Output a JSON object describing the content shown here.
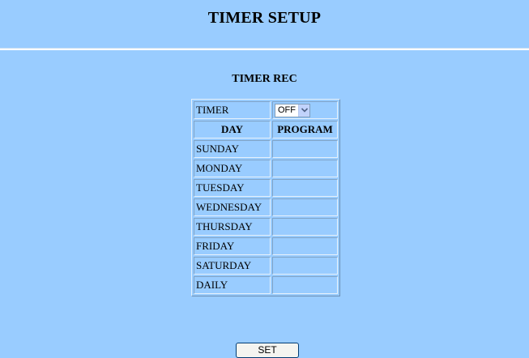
{
  "page": {
    "title": "TIMER SETUP"
  },
  "section": {
    "title": "TIMER REC"
  },
  "timer": {
    "label": "TIMER",
    "selected": "OFF"
  },
  "table": {
    "headers": [
      "DAY",
      "PROGRAM"
    ],
    "rows": [
      {
        "day": "SUNDAY",
        "program": ""
      },
      {
        "day": "MONDAY",
        "program": ""
      },
      {
        "day": "TUESDAY",
        "program": ""
      },
      {
        "day": "WEDNESDAY",
        "program": ""
      },
      {
        "day": "THURSDAY",
        "program": ""
      },
      {
        "day": "FRIDAY",
        "program": ""
      },
      {
        "day": "SATURDAY",
        "program": ""
      },
      {
        "day": "DAILY",
        "program": ""
      }
    ]
  },
  "actions": {
    "set_label": "SET"
  },
  "colors": {
    "background": "#99ccff",
    "cell_border": "#7fa3c7"
  }
}
